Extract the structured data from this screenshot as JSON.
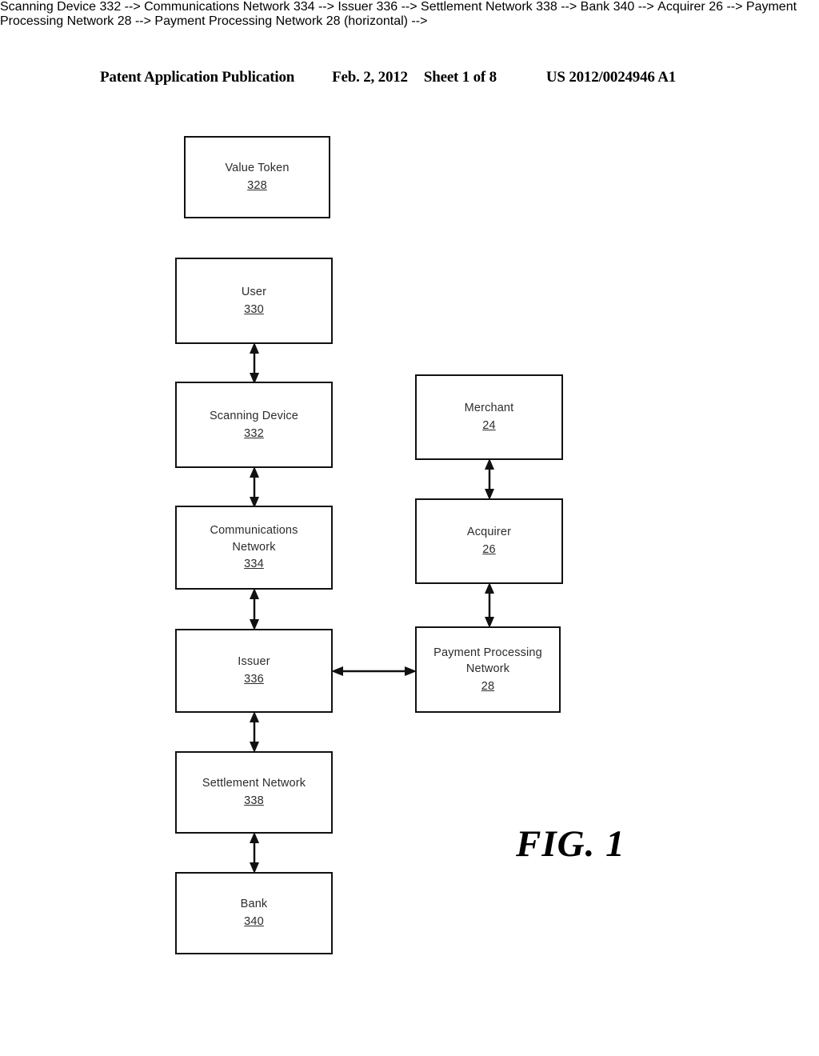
{
  "header": {
    "publication": "Patent Application Publication",
    "date": "Feb. 2, 2012",
    "sheet": "Sheet 1 of 8",
    "document_number": "US 2012/0024946 A1"
  },
  "figure": {
    "label": "FIG. 1",
    "caption": ""
  },
  "diagram": {
    "nodes": [
      {
        "id": "value-token",
        "label": "Value Token",
        "ref": "328"
      },
      {
        "id": "user",
        "label": "User",
        "ref": "330"
      },
      {
        "id": "scanning-device",
        "label": "Scanning Device",
        "ref": "332"
      },
      {
        "id": "comm-network",
        "label": "Communications\nNetwork",
        "ref": "334"
      },
      {
        "id": "issuer",
        "label": "Issuer",
        "ref": "336"
      },
      {
        "id": "settlement",
        "label": "Settlement Network",
        "ref": "338"
      },
      {
        "id": "bank",
        "label": "Bank",
        "ref": "340"
      },
      {
        "id": "merchant",
        "label": "Merchant",
        "ref": "24"
      },
      {
        "id": "acquirer",
        "label": "Acquirer",
        "ref": "26"
      },
      {
        "id": "payment-network",
        "label": "Payment Processing\nNetwork",
        "ref": "28"
      }
    ],
    "connectors": [
      {
        "from": "user",
        "to": "scanning-device",
        "style": "double-arrow-vertical"
      },
      {
        "from": "scanning-device",
        "to": "comm-network",
        "style": "double-arrow-vertical"
      },
      {
        "from": "comm-network",
        "to": "issuer",
        "style": "double-arrow-vertical"
      },
      {
        "from": "issuer",
        "to": "settlement",
        "style": "double-arrow-vertical"
      },
      {
        "from": "settlement",
        "to": "bank",
        "style": "double-arrow-vertical"
      },
      {
        "from": "merchant",
        "to": "acquirer",
        "style": "double-arrow-vertical"
      },
      {
        "from": "acquirer",
        "to": "payment-network",
        "style": "double-arrow-vertical"
      },
      {
        "from": "issuer",
        "to": "payment-network",
        "style": "double-arrow-horizontal"
      }
    ],
    "colors": {
      "stroke": "#111111",
      "text": "#2c2c2c",
      "background": "#ffffff"
    }
  }
}
